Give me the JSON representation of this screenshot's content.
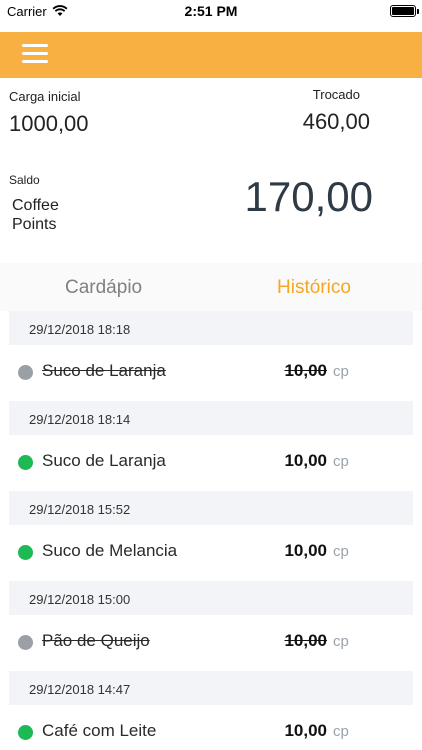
{
  "status_bar": {
    "carrier": "Carrier",
    "time": "2:51 PM"
  },
  "header": {
    "menu_icon": "hamburger-menu-icon",
    "color": "#f9b042"
  },
  "balance": {
    "initial_label": "Carga inicial",
    "initial_value": "1000,00",
    "exchanged_label": "Trocado",
    "exchanged_value": "460,00",
    "saldo_label": "Saldo",
    "unit_label": "Coffee Points",
    "saldo_value": "170,00"
  },
  "tabs": {
    "menu": "Cardápio",
    "history": "Histórico",
    "active": "history",
    "active_color": "#f5a623"
  },
  "history": [
    {
      "date": "29/12/2018 18:18",
      "name": "Suco de Laranja",
      "price": "10,00",
      "unit": "cp",
      "canceled": true
    },
    {
      "date": "29/12/2018 18:14",
      "name": "Suco de Laranja",
      "price": "10,00",
      "unit": "cp",
      "canceled": false
    },
    {
      "date": "29/12/2018 15:52",
      "name": "Suco de Melancia",
      "price": "10,00",
      "unit": "cp",
      "canceled": false
    },
    {
      "date": "29/12/2018 15:00",
      "name": "Pão de Queijo",
      "price": "10,00",
      "unit": "cp",
      "canceled": true
    },
    {
      "date": "29/12/2018 14:47",
      "name": "Café com Leite",
      "price": "10,00",
      "unit": "cp",
      "canceled": false
    }
  ],
  "colors": {
    "active_dot": "#1db954",
    "canceled_dot": "#9aa0a6"
  }
}
